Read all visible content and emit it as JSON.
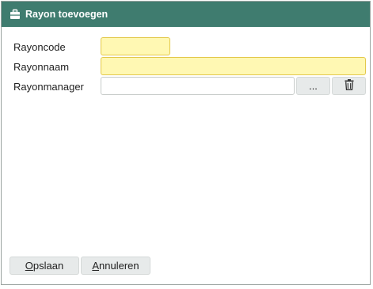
{
  "dialog": {
    "title": "Rayon toevoegen",
    "title_icon": "briefcase-icon"
  },
  "form": {
    "rayoncode_label": "Rayoncode",
    "rayoncode_value": "",
    "rayonnaam_label": "Rayonnaam",
    "rayonnaam_value": "",
    "rayonmanager_label": "Rayonmanager",
    "rayonmanager_value": "",
    "browse_label": "...",
    "delete_icon": "trash-icon"
  },
  "footer": {
    "save_accel": "O",
    "save_rest": "pslaan",
    "cancel_accel": "A",
    "cancel_rest": "nnuleren"
  },
  "colors": {
    "titlebar": "#3f7c6f",
    "required_field": "#fff8b3",
    "button": "#e7eaea"
  }
}
